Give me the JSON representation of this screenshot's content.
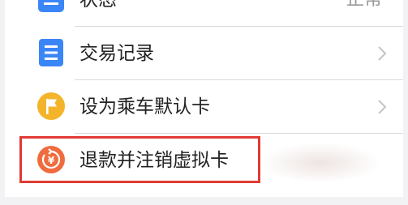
{
  "menu": {
    "status": {
      "label": "状态",
      "value": "正常",
      "icon": "status-list-icon"
    },
    "records": {
      "label": "交易记录",
      "icon": "document-list-icon",
      "color": "#3b86f7"
    },
    "default_card": {
      "label": "设为乘车默认卡",
      "icon": "flag-icon",
      "color": "#f4b42a"
    },
    "refund": {
      "label": "退款并注销虚拟卡",
      "icon": "refund-yen-icon",
      "color": "#ef6c3e"
    }
  },
  "highlight_color": "#e03a33"
}
